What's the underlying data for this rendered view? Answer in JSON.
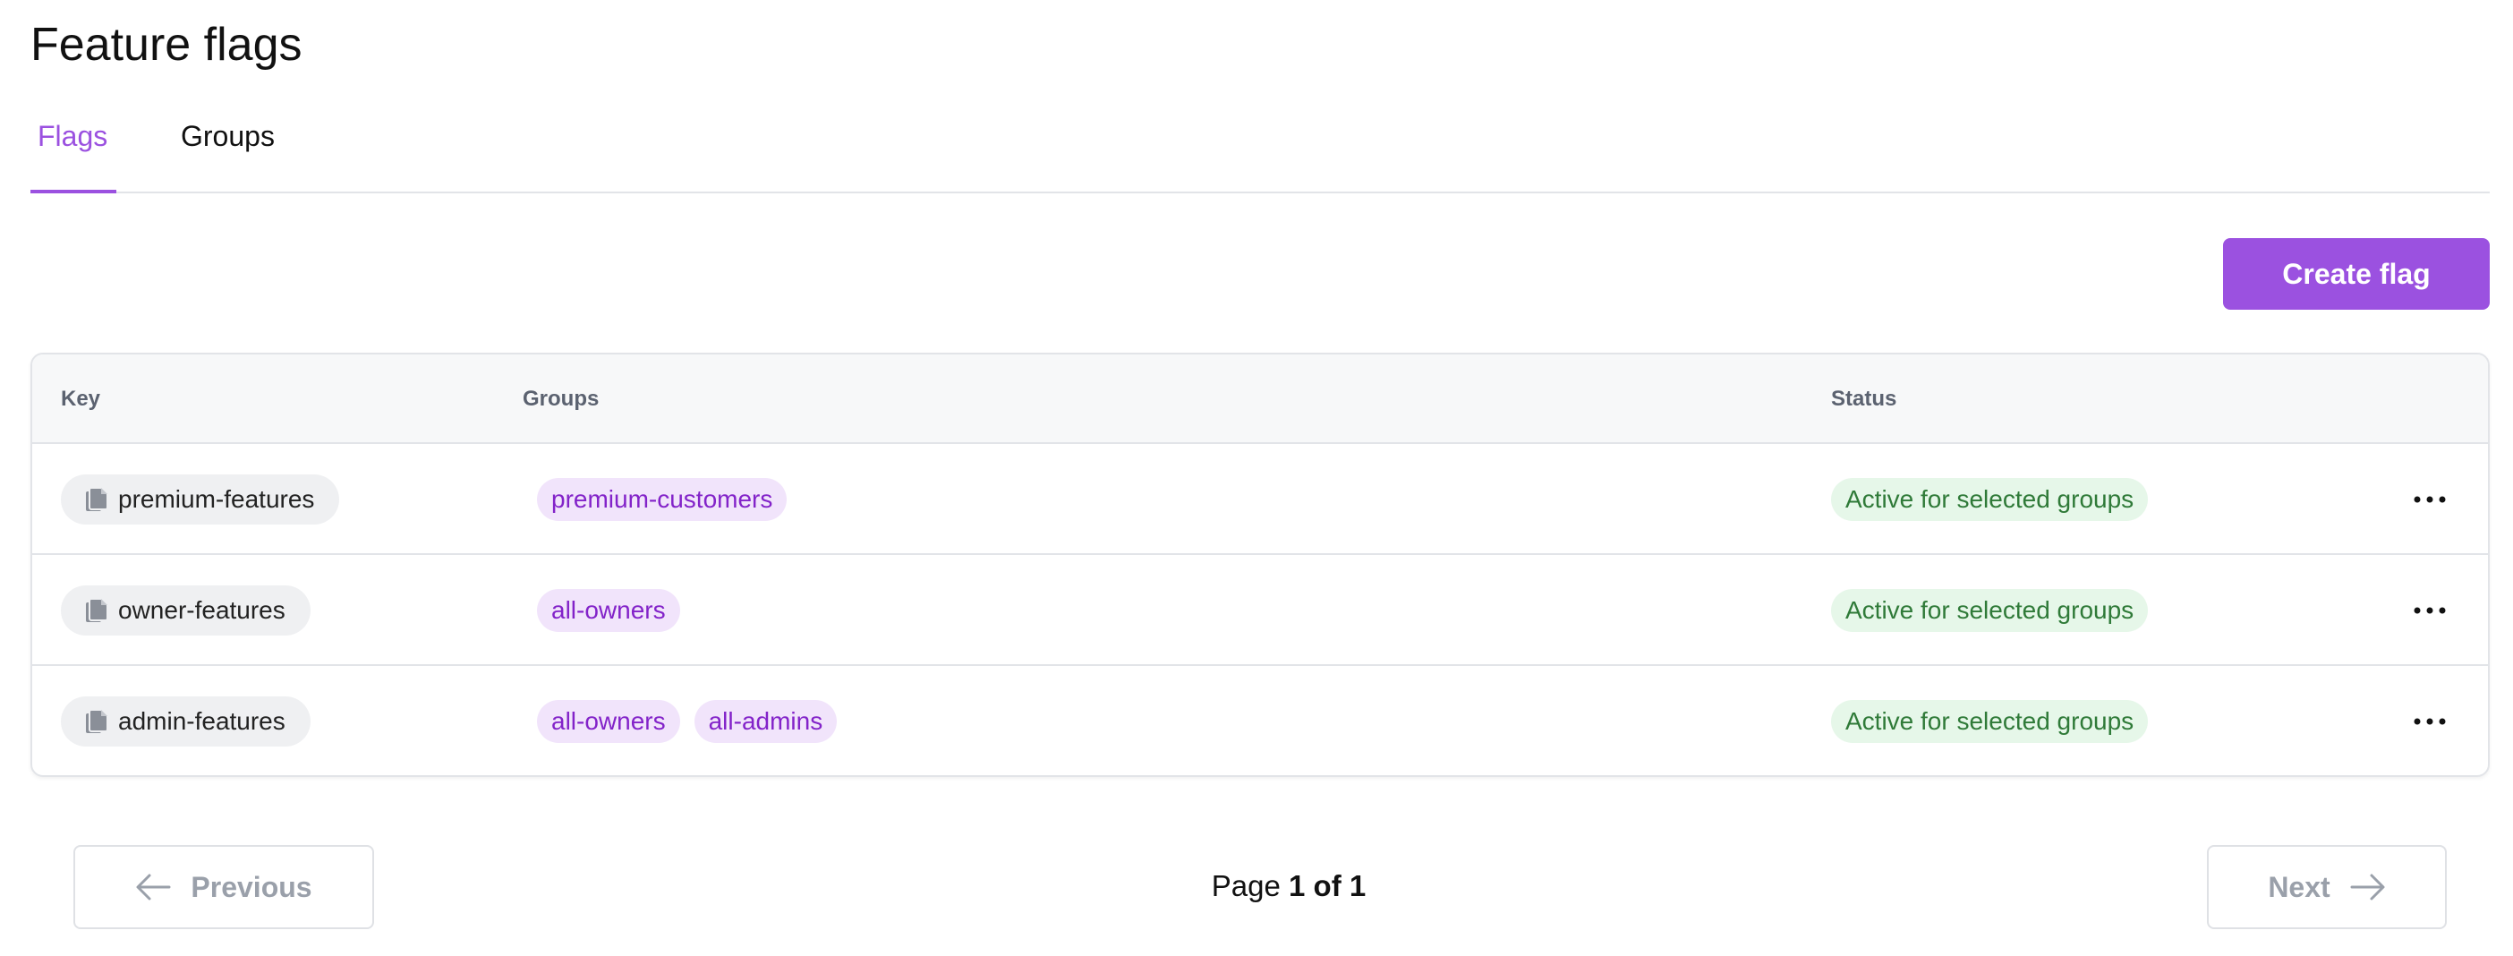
{
  "page": {
    "title": "Feature flags"
  },
  "tabs": [
    {
      "label": "Flags",
      "active": true
    },
    {
      "label": "Groups",
      "active": false
    }
  ],
  "toolbar": {
    "create_label": "Create flag"
  },
  "table": {
    "columns": {
      "key": "Key",
      "groups": "Groups",
      "status": "Status"
    },
    "rows": [
      {
        "key": "premium-features",
        "groups": [
          "premium-customers"
        ],
        "status": "Active for selected groups"
      },
      {
        "key": "owner-features",
        "groups": [
          "all-owners"
        ],
        "status": "Active for selected groups"
      },
      {
        "key": "admin-features",
        "groups": [
          "all-owners",
          "all-admins"
        ],
        "status": "Active for selected groups"
      }
    ]
  },
  "pagination": {
    "previous_label": "Previous",
    "next_label": "Next",
    "page_prefix": "Page",
    "page_value": "1 of 1"
  },
  "icons": {
    "key": "copy-icon",
    "row_menu": "more-horizontal-icon",
    "previous": "arrow-left-icon",
    "next": "arrow-right-icon"
  },
  "colors": {
    "accent": "#9b51e0",
    "group_bg": "#f1e4fb",
    "group_text": "#8323c9",
    "status_bg": "#e6f7e9",
    "status_text": "#2f7a38"
  }
}
